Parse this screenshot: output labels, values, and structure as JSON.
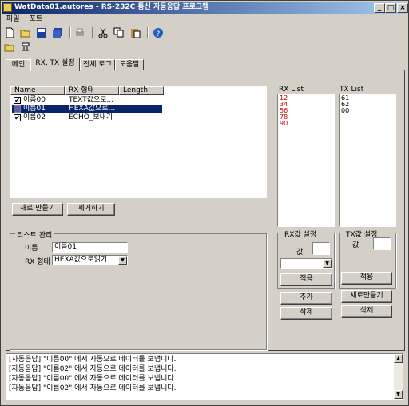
{
  "window": {
    "title": "WatData01.autores - RS-232C 통신 자동응답 프로그램",
    "minimize": "_",
    "maximize": "□",
    "close": "×"
  },
  "menu": [
    "파일",
    "포트"
  ],
  "tabs": [
    "메인",
    "RX, TX 설정",
    "전체 로그",
    "도움말"
  ],
  "listview": {
    "columns": [
      "Name",
      "RX 형태",
      "Length"
    ],
    "rows": [
      {
        "checked": true,
        "name": "이름00",
        "rx": "TEXT값으로...",
        "selected": false
      },
      {
        "checked": false,
        "name": "이름01",
        "rx": "HEXA값으로...",
        "selected": true
      },
      {
        "checked": true,
        "name": "이름02",
        "rx": "ECHO_보내기",
        "selected": false
      }
    ]
  },
  "buttons": {
    "new": "새로 만들기",
    "remove": "제거하기",
    "rx_apply": "적용",
    "tx_apply": "적용",
    "add": "추가",
    "rx_delete": "삭제",
    "new2": "새로만들기",
    "tx_delete": "삭제"
  },
  "rx_list": {
    "label": "RX List",
    "items": [
      "12",
      "34",
      "56",
      "78",
      "90"
    ],
    "color": "#cc0000"
  },
  "tx_list": {
    "label": "TX List",
    "items": [
      "61",
      "62",
      "00"
    ]
  },
  "list_manage": {
    "title": "리스트 관리",
    "name_label": "이름",
    "name_value": "이름01",
    "rx_label": "RX 형태",
    "rx_value": "HEXA값으로읽기"
  },
  "rx_setting": {
    "title": "RX값 설정",
    "value_label": "값",
    "value": "",
    "combo": ""
  },
  "tx_setting": {
    "title": "TX값 설정",
    "value_label": "값",
    "value": ""
  },
  "log": [
    "[자동응답] \"이름00\" 에서 자동으로 데이터를 보냅니다.",
    "[자동응답] \"이름02\" 에서 자동으로 데이터를 보냅니다.",
    "[자동응답] \"이름00\" 에서 자동으로 데이터를 보냅니다.",
    "[자동응답] \"이름02\" 에서 자동으로 데이터를 보냅니다."
  ],
  "toolbar": [
    "new-file-icon",
    "open-folder-icon",
    "save-icon",
    "save-all-icon",
    "print-icon",
    "cut-icon",
    "copy-icon",
    "paste-icon",
    "help-icon"
  ],
  "toolbar2": [
    "open-folder-icon",
    "run-icon"
  ]
}
